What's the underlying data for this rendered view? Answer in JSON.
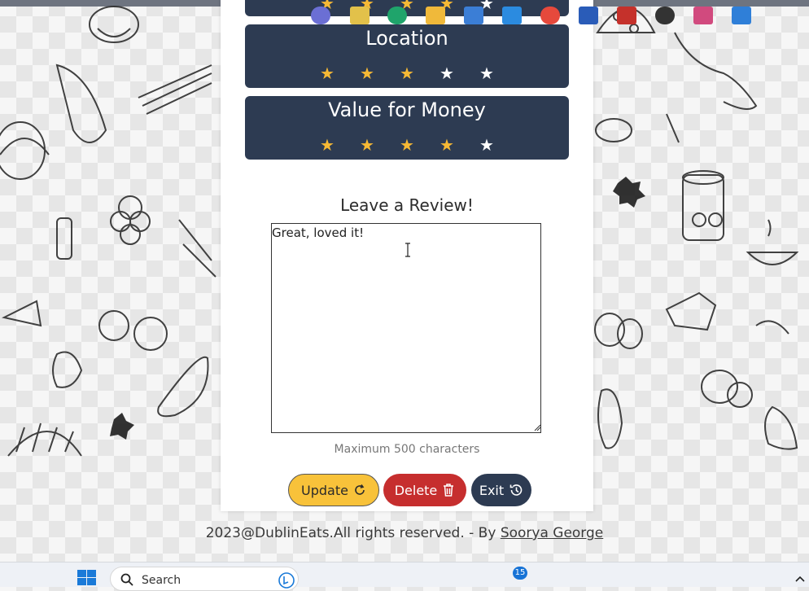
{
  "ratings": [
    {
      "title": "Location",
      "stars_filled": 3,
      "stars_total": 5
    },
    {
      "title": "Value for Money",
      "stars_filled": 4,
      "stars_total": 5
    }
  ],
  "top_partial_card": {
    "stars_filled": 4,
    "stars_total": 5
  },
  "review": {
    "heading": "Leave a Review!",
    "text": "Great, loved it!",
    "hint": "Maximum 500 characters"
  },
  "buttons": {
    "update": "Update",
    "delete": "Delete",
    "exit": "Exit"
  },
  "footer": {
    "text": "2023@DublinEats.All rights reserved. - By ",
    "author": "Soorya George"
  },
  "taskbar": {
    "search_label": "Search",
    "mail_badge": "15"
  },
  "colors": {
    "card_bg": "#2d3b52",
    "star_on": "#f6b935",
    "star_off": "#ffffff",
    "update_btn": "#f8c23a",
    "delete_btn": "#c62e2e",
    "exit_btn": "#2d3b52"
  }
}
